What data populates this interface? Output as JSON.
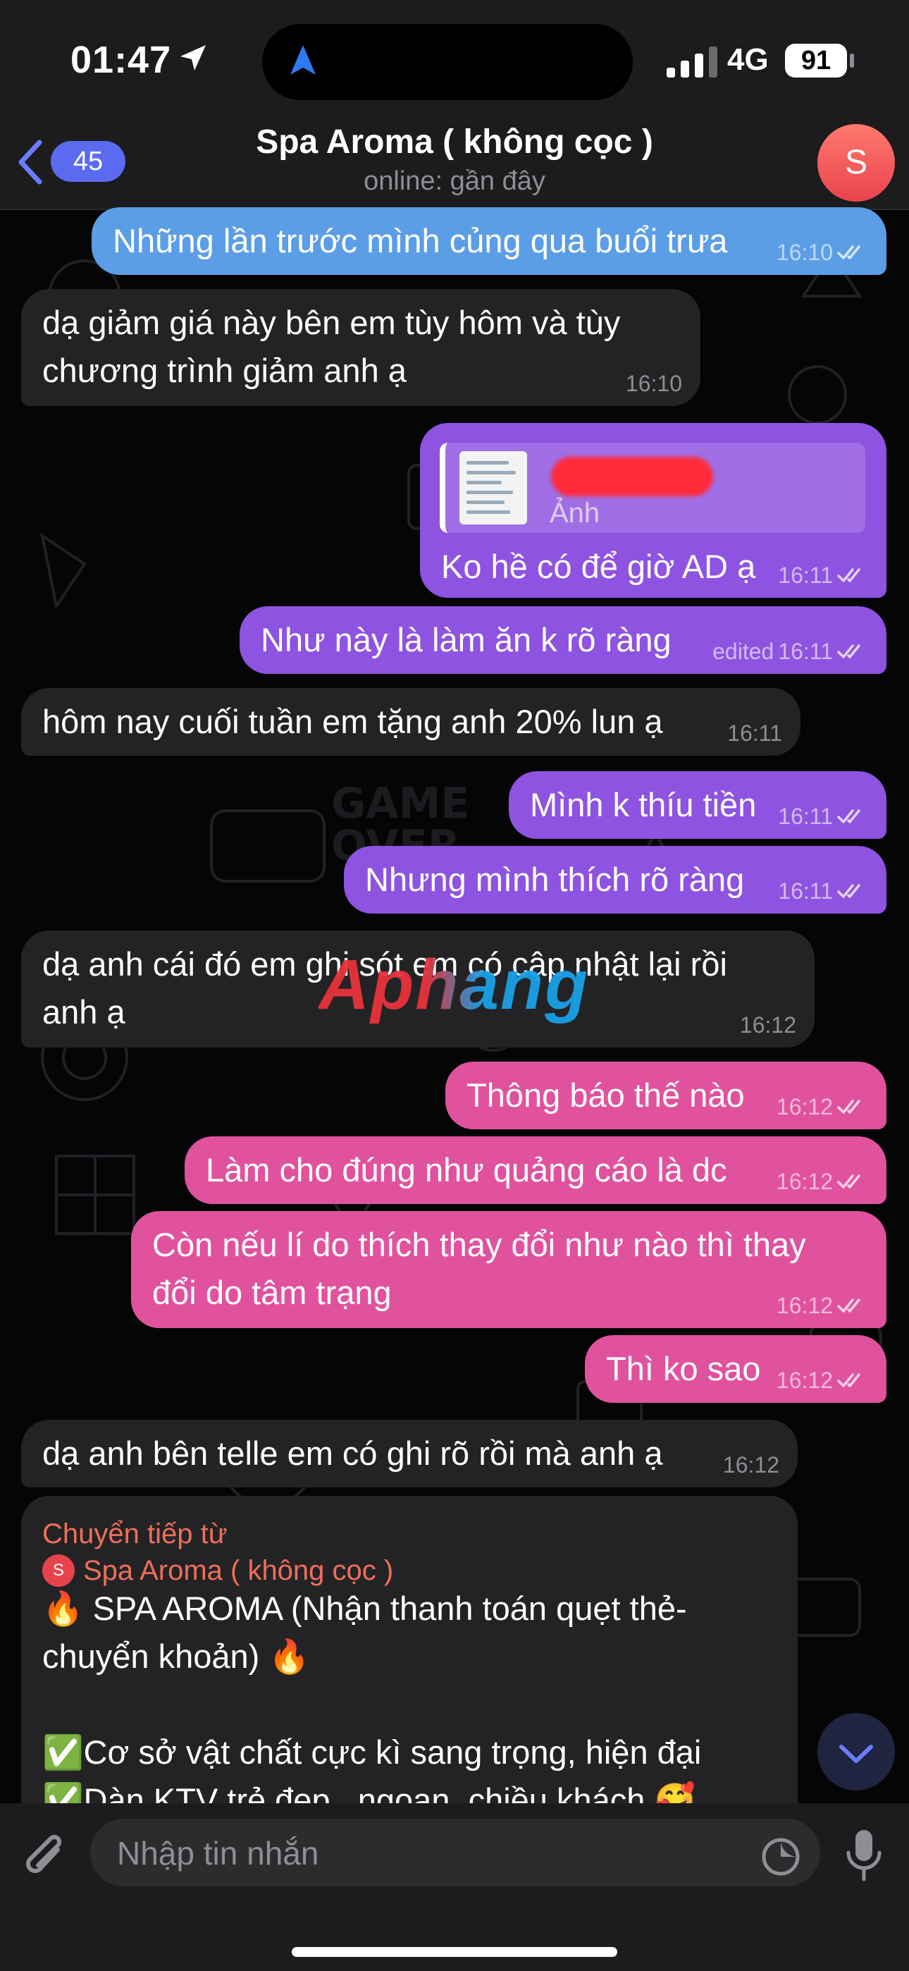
{
  "status_bar": {
    "time": "01:47",
    "network": "4G",
    "battery": "91"
  },
  "header": {
    "back_count": "45",
    "title": "Spa Aroma ( không cọc )",
    "subtitle": "online: gần đây",
    "avatar_letter": "S"
  },
  "messages": [
    {
      "dir": "out",
      "text": [
        "Những lần trước mình củng qua buổi trưa"
      ],
      "time": "16:10"
    },
    {
      "dir": "in",
      "text": [
        "dạ giảm giá này bên em tùy hôm và tùy",
        "chương trình giảm anh ạ"
      ],
      "time": "16:10"
    },
    {
      "dir": "out",
      "text": [
        "Ko hề có để giờ AD ạ"
      ],
      "time": "16:11",
      "reply_label": "Ảnh"
    },
    {
      "dir": "out",
      "text": [
        "Như này là làm ăn k rõ ràng"
      ],
      "time": "16:11",
      "edited": "edited"
    },
    {
      "dir": "in",
      "text": [
        "hôm nay cuối tuần em tặng anh 20% lun ạ"
      ],
      "time": "16:11"
    },
    {
      "dir": "out",
      "text": [
        "Mình k thíu tiền"
      ],
      "time": "16:11"
    },
    {
      "dir": "out",
      "text": [
        "Nhưng mình thích rõ ràng"
      ],
      "time": "16:11"
    },
    {
      "dir": "in",
      "text": [
        "dạ anh cái đó em ghi sót em có cập nhật lại rồi",
        "anh ạ"
      ],
      "time": "16:12"
    },
    {
      "dir": "out",
      "text": [
        "Thông báo thế nào"
      ],
      "time": "16:12"
    },
    {
      "dir": "out",
      "text": [
        "Làm cho đúng như quảng cáo là dc"
      ],
      "time": "16:12"
    },
    {
      "dir": "out",
      "text": [
        "Còn nếu lí do thích thay đổi như nào thì thay",
        "đổi do tâm trạng"
      ],
      "time": "16:12"
    },
    {
      "dir": "out",
      "text": [
        "Thì ko sao"
      ],
      "time": "16:12"
    },
    {
      "dir": "in",
      "text": [
        "dạ anh bên telle em có ghi rõ rồi mà anh ạ"
      ],
      "time": "16:12"
    }
  ],
  "forwarded": {
    "header": "Chuyển tiếp từ",
    "from": "Spa Aroma ( không cọc )",
    "from_initial": "S",
    "lines": [
      "🔥 SPA AROMA  (Nhận thanh toán quẹt thẻ-",
      "chuyển khoản) 🔥",
      "",
      "✅Cơ sở vật chất cực kì sang trọng, hiện đại",
      "✅Dàn KTV trẻ đẹp , ngoan ,chiều khách 🥰"
    ]
  },
  "watermark": "Aphang",
  "input": {
    "placeholder": "Nhập tin nhắn"
  },
  "colors": {
    "bubble_top": "#5b9ee6",
    "bubble_mid": "#8e53e0",
    "bubble_bottom": "#e0529e",
    "incoming": "#232325",
    "accent": "#5b6bf0",
    "forward_label": "#ef6e5a"
  },
  "icons": [
    "back-chevron-icon",
    "location-arrow-icon",
    "signal-icon",
    "paperclip-icon",
    "sticker-icon",
    "microphone-icon",
    "chevron-down-icon",
    "double-check-icon"
  ]
}
